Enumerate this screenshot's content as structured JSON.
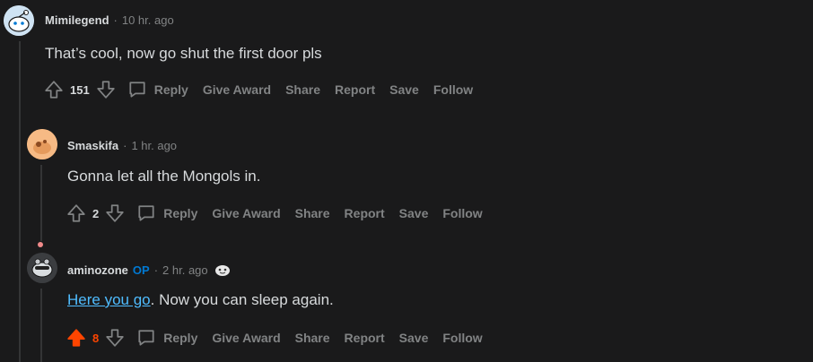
{
  "comments": [
    {
      "username": "Mimilegend",
      "time": "10 hr. ago",
      "dot": "·",
      "text": "That’s cool, now go shut the first door pls",
      "score": "151",
      "actions": {
        "reply": "Reply",
        "award": "Give Award",
        "share": "Share",
        "report": "Report",
        "save": "Save",
        "follow": "Follow"
      }
    },
    {
      "username": "Smaskifa",
      "time": "1 hr. ago",
      "dot": "·",
      "text": "Gonna let all the Mongols in.",
      "score": "2",
      "actions": {
        "reply": "Reply",
        "award": "Give Award",
        "share": "Share",
        "report": "Report",
        "save": "Save",
        "follow": "Follow"
      }
    },
    {
      "username": "aminozone",
      "op_badge": "OP",
      "time": "2 hr. ago",
      "dot": "·",
      "link_text": "Here you go",
      "text_after": ". Now you can sleep again.",
      "score": "8",
      "upvoted": true,
      "actions": {
        "reply": "Reply",
        "award": "Give Award",
        "share": "Share",
        "report": "Report",
        "save": "Save",
        "follow": "Follow"
      }
    }
  ],
  "colors": {
    "upvote_active": "#ff4500",
    "op": "#0079d3",
    "link": "#4fbcff",
    "muted": "#818384"
  }
}
